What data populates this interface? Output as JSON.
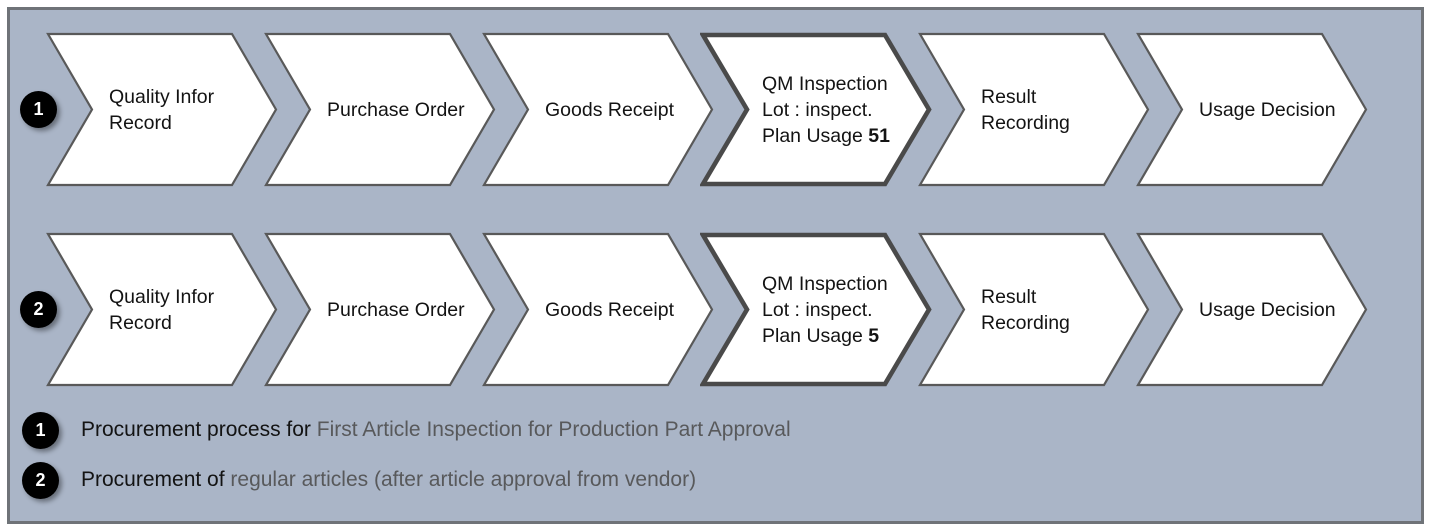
{
  "diagram": {
    "title": "Procurement process chevron flow",
    "background_color": "#aab5c7",
    "frame_border_color": "#6f7378",
    "chevron_fill": "#ffffff",
    "chevron_border_color": "#595959",
    "chevron_highlight_border_color": "#4a4a4a",
    "badge_color": "#000000",
    "text_color": "#131313",
    "muted_text_color": "#58595b"
  },
  "rows": [
    {
      "badge": "1",
      "steps": [
        {
          "label_lines": [
            "Quality Infor",
            "Record"
          ],
          "highlighted": false,
          "align": "left"
        },
        {
          "label_lines": [
            "Purchase Order"
          ],
          "highlighted": false,
          "align": "left"
        },
        {
          "label_lines": [
            "Goods Receipt"
          ],
          "highlighted": false,
          "align": "left"
        },
        {
          "label_lines": [
            "QM Inspection",
            "Lot : inspect.",
            "Plan Usage "
          ],
          "emphasis": "51",
          "highlighted": true,
          "align": "left"
        },
        {
          "label_lines": [
            "Result",
            "Recording"
          ],
          "highlighted": false,
          "align": "left"
        },
        {
          "label_lines": [
            "Usage Decision"
          ],
          "highlighted": false,
          "align": "left"
        }
      ]
    },
    {
      "badge": "2",
      "steps": [
        {
          "label_lines": [
            "Quality Infor",
            "Record"
          ],
          "highlighted": false,
          "align": "left"
        },
        {
          "label_lines": [
            "Purchase Order"
          ],
          "highlighted": false,
          "align": "left"
        },
        {
          "label_lines": [
            "Goods Receipt"
          ],
          "highlighted": false,
          "align": "left"
        },
        {
          "label_lines": [
            "QM Inspection",
            "Lot : inspect.",
            "Plan Usage "
          ],
          "emphasis": "5",
          "highlighted": true,
          "align": "left"
        },
        {
          "label_lines": [
            "Result",
            "Recording"
          ],
          "highlighted": false,
          "align": "left"
        },
        {
          "label_lines": [
            "Usage Decision"
          ],
          "highlighted": false,
          "align": "left"
        }
      ]
    }
  ],
  "legend": [
    {
      "badge": "1",
      "lead": "Procurement process for ",
      "detail": "First Article Inspection for Production Part Approval"
    },
    {
      "badge": "2",
      "lead": "Procurement of ",
      "detail": "regular articles (after article approval from vendor)"
    }
  ]
}
